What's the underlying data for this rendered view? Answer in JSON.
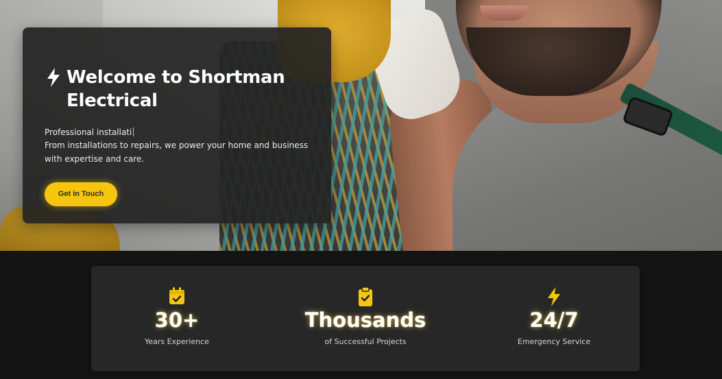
{
  "hero": {
    "title": "Welcome to Shortman Electrical",
    "tagline_typed": "Professional installati",
    "description": "From installations to repairs, we power your home and business with expertise and care.",
    "cta_label": "Get in Touch",
    "icon": "lightning-bolt-icon"
  },
  "stats": [
    {
      "icon": "calendar-check-icon",
      "value": "30+",
      "label": "Years Experience"
    },
    {
      "icon": "clipboard-check-icon",
      "value": "Thousands",
      "label": "of Successful Projects"
    },
    {
      "icon": "lightning-bolt-icon",
      "value": "24/7",
      "label": "Emergency Service"
    }
  ],
  "colors": {
    "accent": "#f6c60f",
    "card_bg": "#242424",
    "stats_bg": "#272727",
    "page_bg": "#141414"
  }
}
